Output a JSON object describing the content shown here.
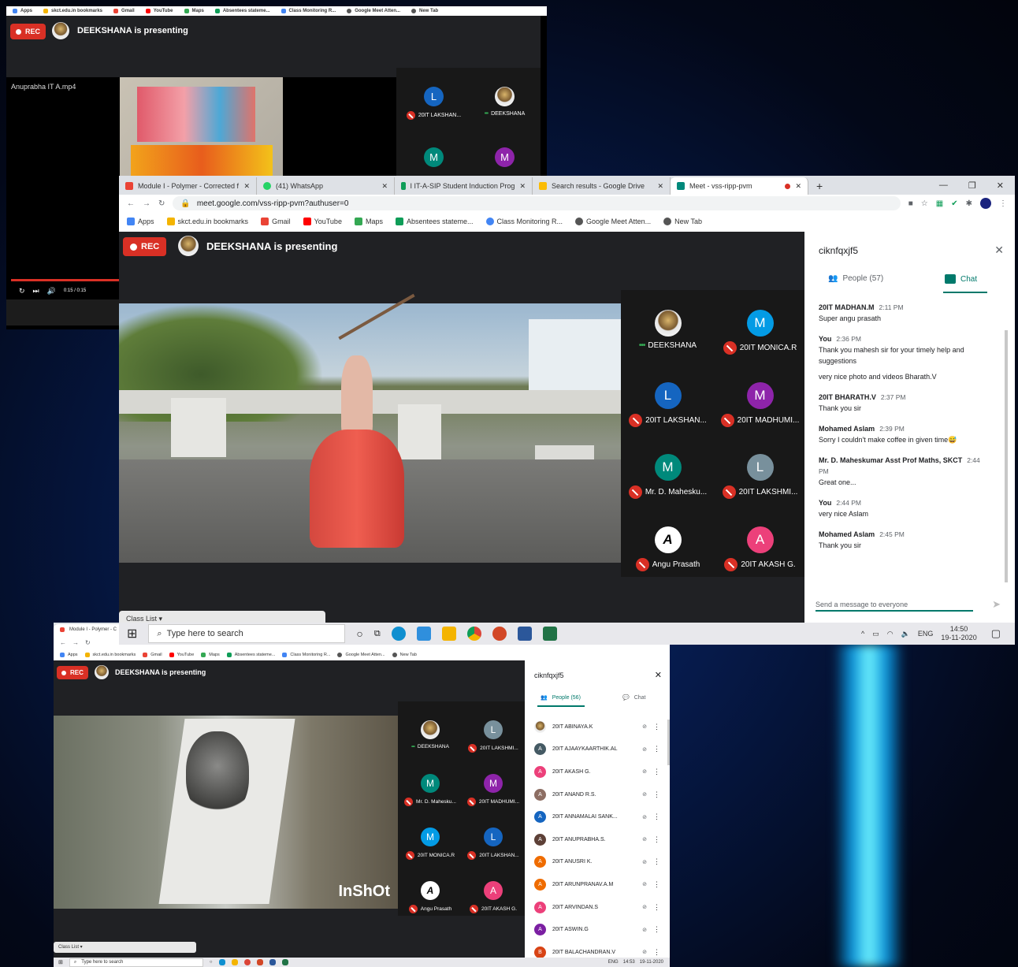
{
  "bookmarks": {
    "apps": "Apps",
    "skct": "skct.edu.in bookmarks",
    "gmail": "Gmail",
    "youtube": "YouTube",
    "maps": "Maps",
    "absentees": "Absentees stateme...",
    "classmon": "Class Monitoring R...",
    "gmeet": "Google Meet Atten...",
    "newtab": "New Tab"
  },
  "rec": "REC",
  "presenting": "DEEKSHANA is presenting",
  "w1": {
    "file_label": "Anuprabha IT A.mp4",
    "time": "0:15 / 0:15",
    "tiles": [
      "20IT LAKSHAN...",
      "DEEKSHANA"
    ],
    "tile_letters": [
      "L",
      "",
      "M",
      "M"
    ]
  },
  "w2": {
    "tabs": [
      "Module I - Polymer - Corrected f",
      "(41) WhatsApp",
      "I IT-A-SIP Student Induction Prog",
      "Search results - Google Drive",
      "Meet - vss-ripp-pvm"
    ],
    "url": "meet.google.com/vss-ripp-pvm?authuser=0",
    "tiles": [
      {
        "l": "",
        "n": "DEEKSHANA",
        "c": "photo"
      },
      {
        "l": "M",
        "n": "20IT MONICA.R",
        "c": "#039be5"
      },
      {
        "l": "L",
        "n": "20IT LAKSHAN...",
        "c": "#1565c0"
      },
      {
        "l": "M",
        "n": "20IT MADHUMI...",
        "c": "#8e24aa"
      },
      {
        "l": "M",
        "n": "Mr. D. Mahesku...",
        "c": "#00897b"
      },
      {
        "l": "L",
        "n": "20IT LAKSHMI...",
        "c": "#78909c"
      },
      {
        "l": "A",
        "n": "Angu Prasath",
        "c": "logo"
      },
      {
        "l": "A",
        "n": "20IT AKASH G.",
        "c": "#ec407a"
      }
    ],
    "meeting_code": "ciknfqxjf5",
    "people_tab": "People (57)",
    "chat_tab": "Chat",
    "messages": [
      {
        "from": "20IT MADHAN.M",
        "time": "2:11 PM",
        "lines": [
          "Super angu prasath"
        ]
      },
      {
        "from": "You",
        "time": "2:36 PM",
        "lines": [
          "Thank you mahesh sir for your timely help and suggestions",
          "very nice photo and videos Bharath.V"
        ]
      },
      {
        "from": "20IT BHARATH.V",
        "time": "2:37 PM",
        "lines": [
          "Thank you sir"
        ]
      },
      {
        "from": "Mohamed Aslam",
        "time": "2:39 PM",
        "lines": [
          "Sorry I couldn't make coffee in given time😅"
        ]
      },
      {
        "from": "Mr. D. Maheskumar Asst Prof Maths, SKCT",
        "time": "2:44 PM",
        "lines": [
          "Great one..."
        ]
      },
      {
        "from": "You",
        "time": "2:44 PM",
        "lines": [
          "very nice Aslam"
        ]
      },
      {
        "from": "Mohamed Aslam",
        "time": "2:45 PM",
        "lines": [
          "Thank you sir"
        ]
      }
    ],
    "send_placeholder": "Send a message to everyone",
    "class_list": "Class List"
  },
  "taskbar": {
    "search": "Type here to search",
    "lang": "ENG",
    "time": "14:50",
    "date": "19-11-2020"
  },
  "w3": {
    "tab": "Module I - Polymer - C",
    "tiles": [
      {
        "l": "",
        "n": "DEEKSHANA",
        "c": "photo"
      },
      {
        "l": "L",
        "n": "20IT LAKSHMI...",
        "c": "#78909c"
      },
      {
        "l": "M",
        "n": "Mr. D. Mahesku...",
        "c": "#00897b"
      },
      {
        "l": "M",
        "n": "20IT MADHUMI...",
        "c": "#8e24aa"
      },
      {
        "l": "M",
        "n": "20IT MONICA.R",
        "c": "#039be5"
      },
      {
        "l": "L",
        "n": "20IT LAKSHAN...",
        "c": "#1565c0"
      },
      {
        "l": "A",
        "n": "Angu Prasath",
        "c": "logo"
      },
      {
        "l": "A",
        "n": "20IT AKASH G.",
        "c": "#ec407a"
      }
    ],
    "meeting_code": "ciknfqxjf5",
    "people_tab": "People (56)",
    "chat_tab": "Chat",
    "people": [
      {
        "l": "",
        "n": "20IT ABINAYA.K",
        "c": "photo"
      },
      {
        "l": "A",
        "n": "20IT AJAAYKAARTHIK.AL",
        "c": "#455a64"
      },
      {
        "l": "A",
        "n": "20IT AKASH G.",
        "c": "#ec407a"
      },
      {
        "l": "A",
        "n": "20IT ANAND R.S.",
        "c": "#8d6e63"
      },
      {
        "l": "A",
        "n": "20IT ANNAMALAI SANK...",
        "c": "#1565c0"
      },
      {
        "l": "A",
        "n": "20IT ANUPRABHA.S.",
        "c": "#5d4037"
      },
      {
        "l": "A",
        "n": "20IT ANUSRI K.",
        "c": "#ef6c00"
      },
      {
        "l": "A",
        "n": "20IT ARUNPRANAV.A.M",
        "c": "#ef6c00"
      },
      {
        "l": "A",
        "n": "20IT ARVINDAN.S",
        "c": "#ec407a"
      },
      {
        "l": "A",
        "n": "20IT ASWIN.G",
        "c": "#7b1fa2"
      },
      {
        "l": "B",
        "n": "20IT BALACHANDRAN.V",
        "c": "#d84315"
      }
    ],
    "inshot": "InShOt",
    "class_list": "Class List",
    "time": "14:53",
    "date": "19-11-2020",
    "lang": "ENG"
  }
}
